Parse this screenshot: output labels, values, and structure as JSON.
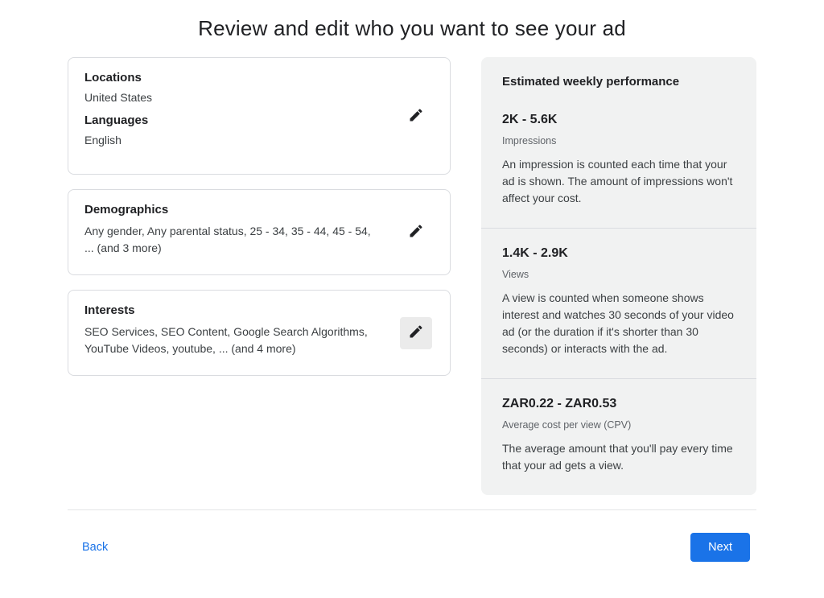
{
  "title": "Review and edit who you want to see your ad",
  "left": {
    "locLang": {
      "locationsHeading": "Locations",
      "locationsValue": "United States",
      "languagesHeading": "Languages",
      "languagesValue": "English"
    },
    "demographics": {
      "heading": "Demographics",
      "value": "Any gender, Any parental status, 25 - 34, 35 - 44, 45 - 54, ... (and 3 more)"
    },
    "interests": {
      "heading": "Interests",
      "value": "SEO Services, SEO Content, Google Search Algorithms, YouTube Videos, youtube, ... (and 4 more)"
    }
  },
  "right": {
    "heading": "Estimated weekly performance",
    "metrics": [
      {
        "value": "2K - 5.6K",
        "label": "Impressions",
        "explain": "An impression is counted each time that your ad is shown. The amount of impressions won't affect your cost."
      },
      {
        "value": "1.4K - 2.9K",
        "label": "Views",
        "explain": "A view is counted when someone shows interest and watches 30 seconds of your video ad (or the duration if it's shorter than 30 seconds) or interacts with the ad."
      },
      {
        "value": "ZAR0.22 - ZAR0.53",
        "label": "Average cost per view (CPV)",
        "explain": "The average amount that you'll pay every time that your ad gets a view."
      }
    ]
  },
  "footer": {
    "back": "Back",
    "next": "Next"
  }
}
